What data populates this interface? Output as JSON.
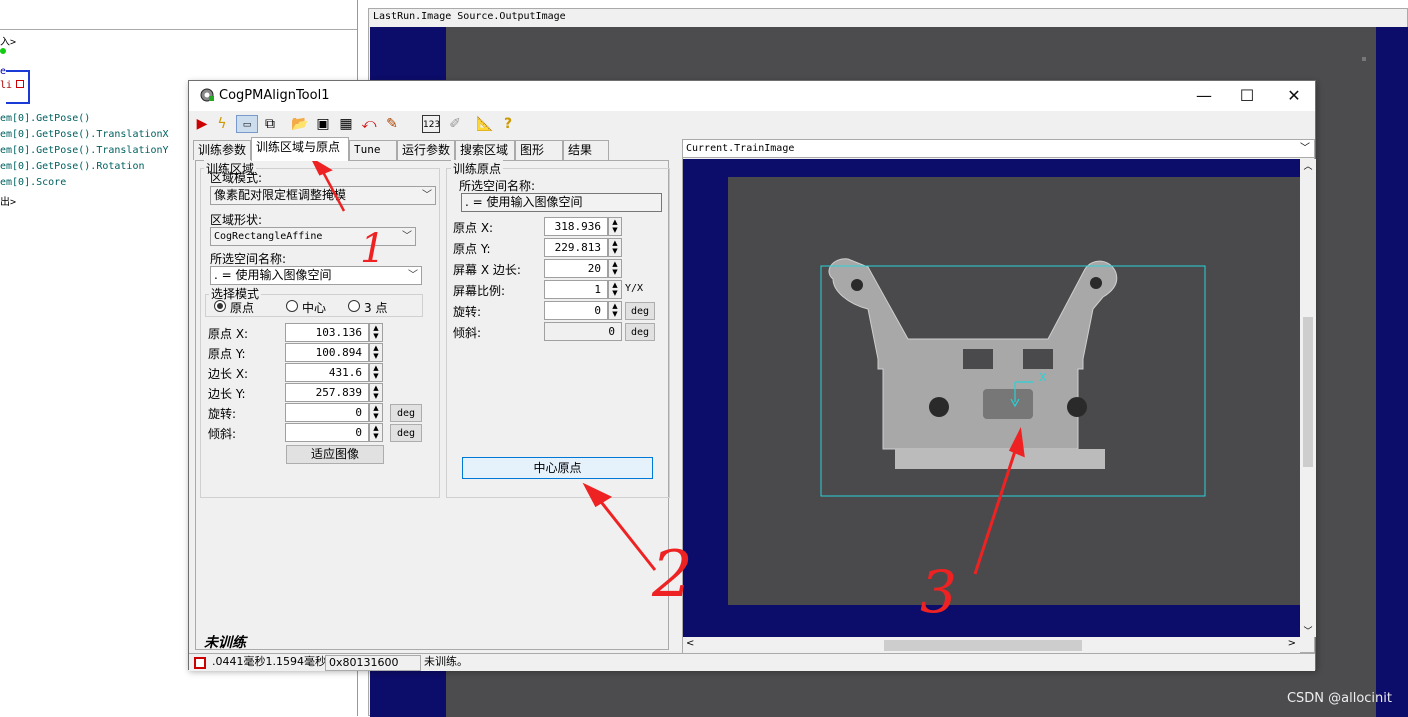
{
  "left_panel": {
    "lines": [
      {
        "text": "入>",
        "color": "#000000"
      },
      {
        "text": "e",
        "color": "#0000aa"
      },
      {
        "text": "li",
        "color": "#aa0000"
      },
      {
        "text": "em[0].GetPose()",
        "color": "#006060"
      },
      {
        "text": "em[0].GetPose().TranslationX",
        "color": "#006060"
      },
      {
        "text": "em[0].GetPose().TranslationY",
        "color": "#006060"
      },
      {
        "text": "em[0].GetPose().Rotation",
        "color": "#006060"
      },
      {
        "text": "em[0].Score",
        "color": "#006060"
      },
      {
        "text": "出>",
        "color": "#000000"
      }
    ]
  },
  "right_panel": {
    "title": "LastRun.Image Source.OutputImage"
  },
  "dialog": {
    "title": "CogPMAlignTool1",
    "minimize": "—",
    "maximize": "☐",
    "close": "✕",
    "toolbar_icons": [
      "run-icon",
      "electric-icon",
      "train-icon",
      "copy-icon",
      "open-icon",
      "save-icon",
      "grid-icon",
      "reset-icon",
      "brush-icon",
      "number-icon",
      "pen-icon",
      "ruler-icon",
      "help-icon"
    ],
    "tabs": [
      "训练参数",
      "训练区域与原点",
      "Tune",
      "运行参数",
      "搜索区域",
      "图形",
      "结果"
    ],
    "active_tab": "训练区域与原点",
    "region": {
      "legend": "训练区域",
      "mode_label": "区域模式:",
      "mode_value": "像素配对限定框调整掩模",
      "shape_label": "区域形状:",
      "shape_value": "CogRectangleAffine",
      "space_label": "所选空间名称:",
      "space_value": ". = 使用输入图像空间",
      "select_legend": "选择模式",
      "radio_origin": "原点",
      "radio_center": "中心",
      "radio_3pt": "3 点",
      "fields": [
        {
          "label": "原点 X:",
          "value": "103.136"
        },
        {
          "label": "原点 Y:",
          "value": "100.894"
        },
        {
          "label": "边长 X:",
          "value": "431.6"
        },
        {
          "label": "边长 Y:",
          "value": "257.839"
        },
        {
          "label": "旋转:",
          "value": "0"
        },
        {
          "label": "倾斜:",
          "value": "0"
        }
      ],
      "deg": "deg",
      "fit_button": "适应图像"
    },
    "origin": {
      "legend": "训练原点",
      "space_label": "所选空间名称:",
      "space_value": ". = 使用输入图像空间",
      "fields": [
        {
          "label": "原点 X:",
          "value": "318.936"
        },
        {
          "label": "原点 Y:",
          "value": "229.813"
        },
        {
          "label": "屏幕 X 边长:",
          "value": "20"
        },
        {
          "label": "屏幕比例:",
          "value": "1"
        },
        {
          "label": "旋转:",
          "value": "0"
        },
        {
          "label": "倾斜:",
          "value": "0"
        }
      ],
      "ratio_unit": "Y/X",
      "deg": "deg",
      "center_button": "中心原点"
    },
    "untrained_label": "未训练",
    "viewer_title": "Current.TrainImage",
    "x_marker": "X",
    "status": {
      "time": ".0441毫秒1.1594毫秒",
      "hex": "0x80131600",
      "msg": "未训练。"
    }
  },
  "annotations": [
    "1",
    "2",
    "3"
  ],
  "watermark": "CSDN @allocinit"
}
